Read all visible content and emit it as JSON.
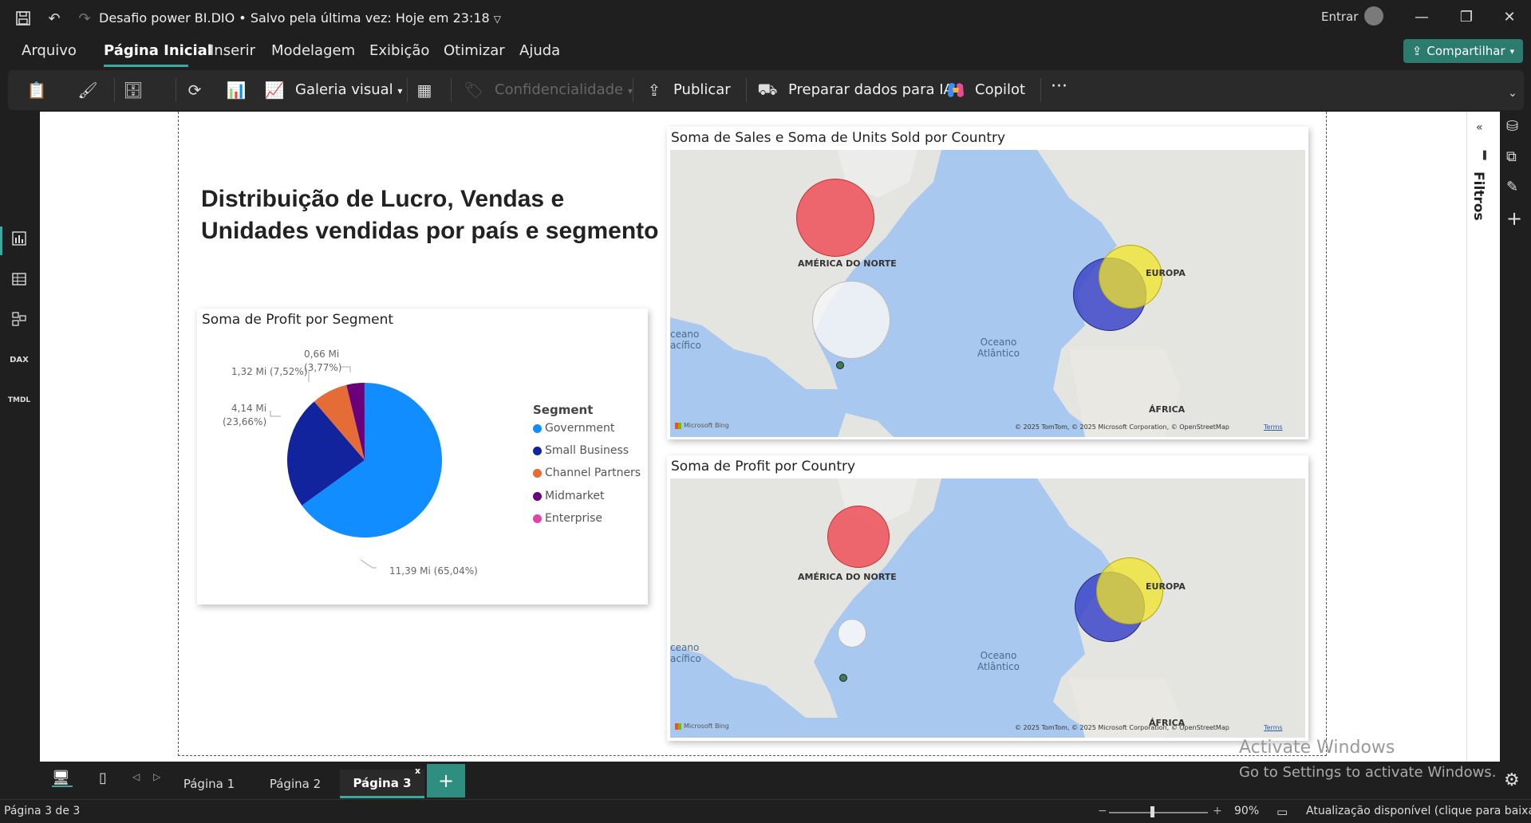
{
  "titlebar": {
    "title": "Desafio power BI.DIO • Salvo pela última vez: Hoje em 23:18",
    "signin": "Entrar"
  },
  "menu": {
    "items": [
      "Arquivo",
      "Página Inicial",
      "Inserir",
      "Modelagem",
      "Exibição",
      "Otimizar",
      "Ajuda"
    ],
    "share": "Compartilhar"
  },
  "ribbon": {
    "gallery": "Galeria visual",
    "sensitivity": "Confidencialidade",
    "publish": "Publicar",
    "prepare": "Preparar dados para IA",
    "copilot": "Copilot",
    "more": "···"
  },
  "report": {
    "title_line1": "Distribuição de Lucro, Vendas e",
    "title_line2": "Unidades vendidas por país e segmento"
  },
  "pie_card": {
    "title": "Soma de Profit por Segment",
    "legend_title": "Segment"
  },
  "chart_data": {
    "type": "pie",
    "title": "Soma de Profit por Segment",
    "categories": [
      "Government",
      "Small Business",
      "Channel Partners",
      "Midmarket",
      "Enterprise"
    ],
    "values": [
      65.04,
      23.66,
      7.52,
      3.77,
      0.01
    ],
    "colors": [
      "#118dff",
      "#12239e",
      "#e66c37",
      "#6b007b",
      "#e044a7"
    ],
    "data_labels": [
      "11,39 Mi (65,04%)",
      "4,14 Mi (23,66%)",
      "1,32 Mi (7,52%)",
      "0,66 Mi (3,77%)",
      ""
    ]
  },
  "pie_labels": {
    "government": "11,39 Mi (65,04%)",
    "small_business_1": "4,14 Mi",
    "small_business_2": "(23,66%)",
    "channel": "1,32 Mi (7,52%)",
    "midmarket_1": "0,66 Mi",
    "midmarket_2": "(3,77%)"
  },
  "map1": {
    "title": "Soma de Sales e Soma de Units Sold por Country"
  },
  "map2": {
    "title": "Soma de Profit por Country"
  },
  "map_labels": {
    "north_america": "AMÉRICA DO NORTE",
    "europe": "EUROPA",
    "africa": "ÁFRICA",
    "ocean_1": "Oceano",
    "ocean_2": "Atlântico",
    "pacific_1": "ceano",
    "pacific_2": "acífico",
    "bing": "Microsoft Bing",
    "copyright": "© 2025 TomTom, © 2025 Microsoft Corporation, © OpenStreetMap",
    "terms": "Terms"
  },
  "filters": {
    "label": "Filtros"
  },
  "tabs": [
    "Página 1",
    "Página 2",
    "Página 3"
  ],
  "watermark": {
    "line1": "Activate Windows",
    "line2": "Go to Settings to activate Windows."
  },
  "status": {
    "page": "Página 3 de 3",
    "zoom": "90%",
    "update": "Atualização disponível (clique para baixar)"
  },
  "colors": {
    "accent": "#3aa9a0",
    "share": "#2b7c6f",
    "bubble_red": "#f0575e",
    "bubble_blue": "#4b55c8",
    "bubble_yellow": "#f2e52c",
    "bubble_white": "#f2f2f2"
  }
}
